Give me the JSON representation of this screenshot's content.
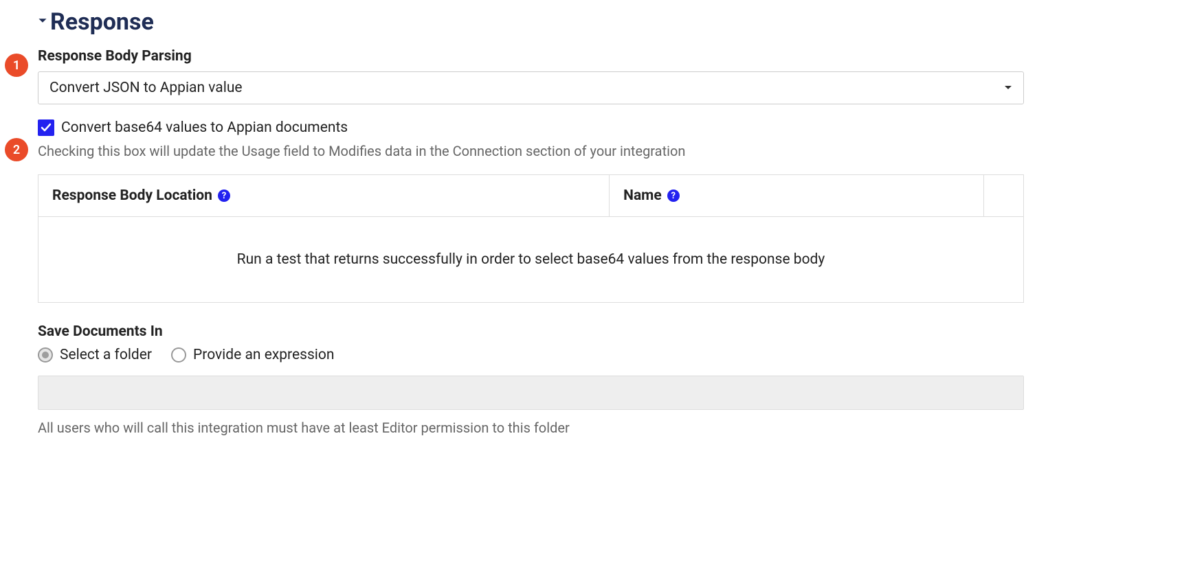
{
  "callouts": [
    "1",
    "2"
  ],
  "section": {
    "title": "Response"
  },
  "parsing": {
    "label": "Response Body Parsing",
    "value": "Convert JSON to Appian value"
  },
  "base64": {
    "label": "Convert base64 values to Appian documents",
    "hint": "Checking this box will update the Usage field to Modifies data in the Connection section of your integration"
  },
  "table": {
    "col1": "Response Body Location",
    "col2": "Name",
    "empty": "Run a test that returns successfully in order to select base64 values from the response body"
  },
  "save": {
    "label": "Save Documents In",
    "opt1": "Select a folder",
    "opt2": "Provide an expression",
    "hint": "All users who will call this integration must have at least Editor permission to this folder"
  },
  "glyphs": {
    "help": "?"
  }
}
